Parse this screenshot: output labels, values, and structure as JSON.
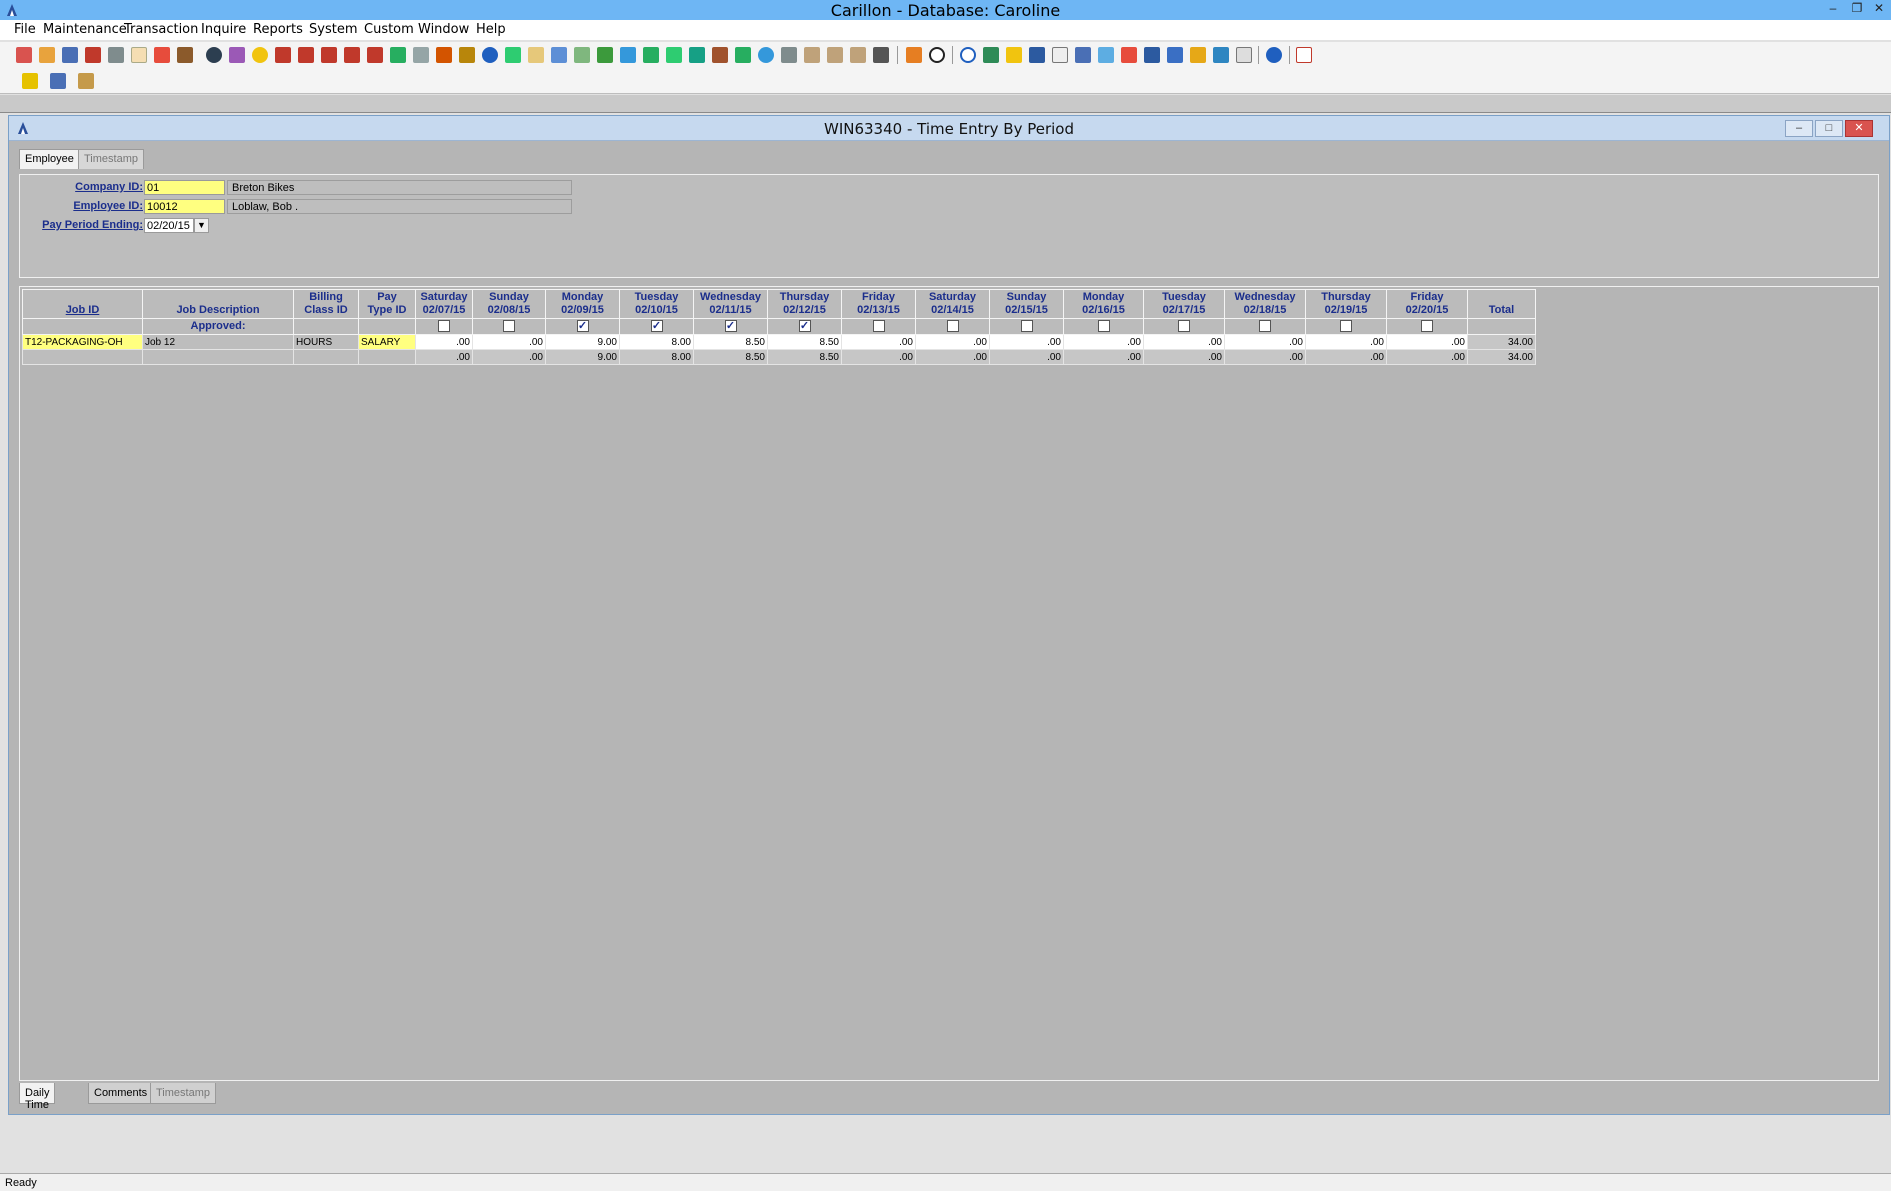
{
  "app": {
    "title": "Carillon - Database: Caroline"
  },
  "menu": [
    "File",
    "Maintenance",
    "Transaction",
    "Inquire",
    "Reports",
    "System",
    "Custom",
    "Window",
    "Help"
  ],
  "window": {
    "title": "WIN63340 - Time Entry By Period"
  },
  "top_tabs": [
    "Employee",
    "Timestamp"
  ],
  "form": {
    "company_label": "Company ID:",
    "company_id": "01",
    "company_name": "Breton Bikes",
    "employee_label": "Employee ID:",
    "employee_id": "10012",
    "employee_name": "Loblaw, Bob .",
    "period_label": "Pay Period Ending:",
    "period_value": "02/20/15"
  },
  "grid": {
    "headers": {
      "job_id": "Job ID",
      "job_desc": "Job Description",
      "billing_1": "Billing",
      "billing_2": "Class ID",
      "pay_1": "Pay",
      "pay_2": "Type ID",
      "total": "Total",
      "approved": "Approved:"
    },
    "days": [
      {
        "day": "Saturday",
        "date": "02/07/15",
        "approved": false,
        "row": ".00",
        "total": ".00"
      },
      {
        "day": "Sunday",
        "date": "02/08/15",
        "approved": false,
        "row": ".00",
        "total": ".00"
      },
      {
        "day": "Monday",
        "date": "02/09/15",
        "approved": true,
        "row": "9.00",
        "total": "9.00"
      },
      {
        "day": "Tuesday",
        "date": "02/10/15",
        "approved": true,
        "row": "8.00",
        "total": "8.00"
      },
      {
        "day": "Wednesday",
        "date": "02/11/15",
        "approved": true,
        "row": "8.50",
        "total": "8.50"
      },
      {
        "day": "Thursday",
        "date": "02/12/15",
        "approved": true,
        "row": "8.50",
        "total": "8.50"
      },
      {
        "day": "Friday",
        "date": "02/13/15",
        "approved": false,
        "row": ".00",
        "total": ".00"
      },
      {
        "day": "Saturday",
        "date": "02/14/15",
        "approved": false,
        "row": ".00",
        "total": ".00"
      },
      {
        "day": "Sunday",
        "date": "02/15/15",
        "approved": false,
        "row": ".00",
        "total": ".00"
      },
      {
        "day": "Monday",
        "date": "02/16/15",
        "approved": false,
        "row": ".00",
        "total": ".00"
      },
      {
        "day": "Tuesday",
        "date": "02/17/15",
        "approved": false,
        "row": ".00",
        "total": ".00"
      },
      {
        "day": "Wednesday",
        "date": "02/18/15",
        "approved": false,
        "row": ".00",
        "total": ".00"
      },
      {
        "day": "Thursday",
        "date": "02/19/15",
        "approved": false,
        "row": ".00",
        "total": ".00"
      },
      {
        "day": "Friday",
        "date": "02/20/15",
        "approved": false,
        "row": ".00",
        "total": ".00"
      }
    ],
    "row": {
      "job_id": "T12-PACKAGING-OH",
      "job_desc": "Job 12",
      "billing_class": "HOURS",
      "pay_type": "SALARY",
      "total": "34.00"
    },
    "totals_row_total": "34.00"
  },
  "bottom_tabs": [
    "Daily Time",
    "Comments",
    "Timestamp"
  ],
  "status": "Ready",
  "colors": {
    "required_field": "#ffff80",
    "label_blue": "#1b2e8c",
    "titlebar": "#6eb6f4"
  }
}
